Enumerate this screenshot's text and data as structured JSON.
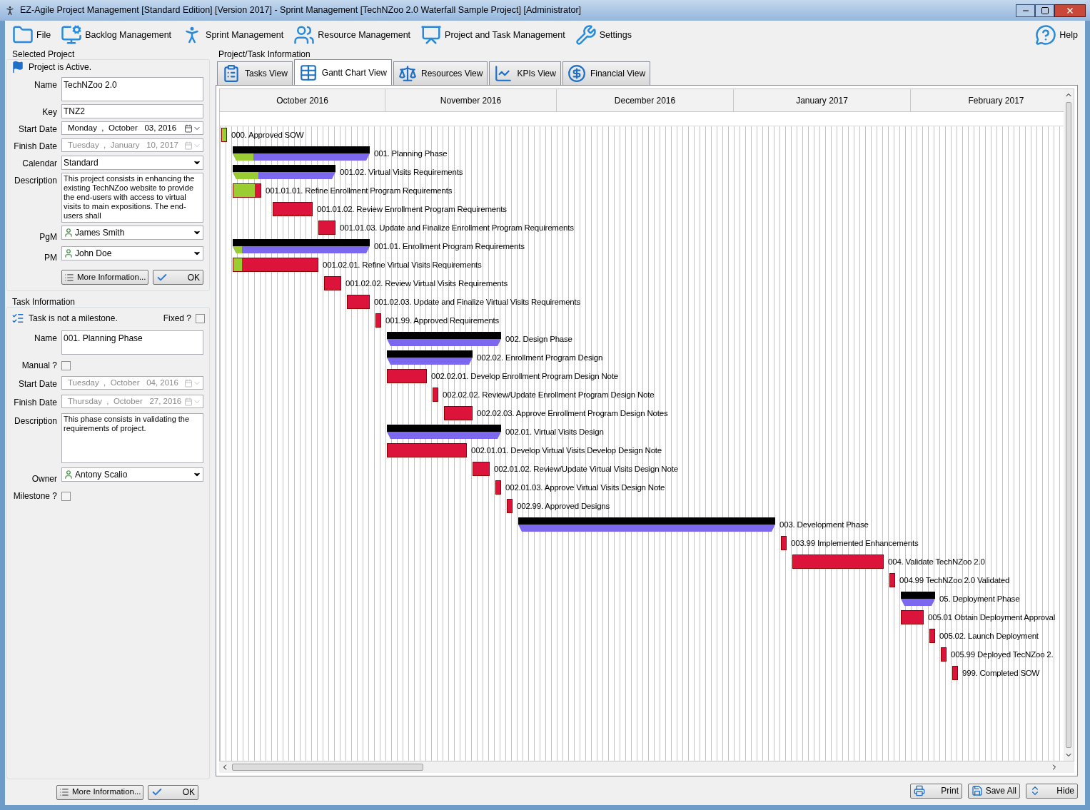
{
  "window": {
    "title": "EZ-Agile Project Management [Standard Edition] [Version 2017] - Sprint Management [TechNZoo 2.0 Waterfall Sample Project] [Administrator]"
  },
  "menu": [
    "File",
    "Backlog Management",
    "Sprint Management",
    "Resource Management",
    "Project and Task Management",
    "Settings"
  ],
  "help": "Help",
  "selected_project": {
    "heading": "Selected Project",
    "status": "Project is Active.",
    "fields": [
      {
        "label": "Name",
        "kind": "box",
        "value": "TechNZoo 2.0"
      },
      {
        "label": "Key",
        "kind": "text",
        "value": "TNZ2"
      },
      {
        "label": "Start Date",
        "kind": "date",
        "value": "Monday  ,  October   03, 2016",
        "disabled": false
      },
      {
        "label": "Finish Date",
        "kind": "date",
        "value": "Tuesday  ,  January   10, 2017",
        "disabled": true
      },
      {
        "label": "Calendar",
        "kind": "select",
        "value": "Standard"
      },
      {
        "label": "Description",
        "kind": "textarea",
        "value": "This project consists in enhancing the existing TechNZoo website to provide the end-users with access to virtual visits to main expositions. The end-users shall"
      },
      {
        "label": "PgM",
        "kind": "person",
        "value": "James Smith"
      },
      {
        "label": "PM",
        "kind": "person",
        "value": "John Doe"
      }
    ],
    "buttons": [
      "More Information...",
      "OK"
    ]
  },
  "task_information": {
    "heading": "Task Information",
    "status": "Task is not a milestone.",
    "fixed": {
      "label": "Fixed ?",
      "checked": false
    },
    "fields": [
      {
        "label": "Name",
        "kind": "box",
        "value": "001. Planning Phase"
      },
      {
        "label": "Manual ?",
        "kind": "checkbox",
        "checked": false
      },
      {
        "label": "Start Date",
        "kind": "date",
        "value": "Tuesday  ,  October   04, 2016",
        "disabled": true
      },
      {
        "label": "Finish Date",
        "kind": "date",
        "value": "Thursday  ,  October   27, 2016",
        "disabled": true
      },
      {
        "label": "Description",
        "kind": "textarea",
        "value": "This phase consists in validating the requirements of project."
      },
      {
        "label": "Owner",
        "kind": "person",
        "value": "Antony Scalio"
      },
      {
        "label": "Milestone ?",
        "kind": "checkbox",
        "checked": false
      }
    ],
    "buttons": [
      "More Information...",
      "OK"
    ]
  },
  "project_task_information": {
    "heading": "Project/Task Information",
    "tabs": [
      {
        "label": "Tasks View",
        "selected": false
      },
      {
        "label": "Gantt Chart View",
        "selected": true
      },
      {
        "label": "Resources View",
        "selected": false
      },
      {
        "label": "KPIs View",
        "selected": false
      },
      {
        "label": "Financial View",
        "selected": false
      }
    ]
  },
  "gantt": {
    "months": [
      "October 2016",
      "November 2016",
      "December 2016",
      "January 2017",
      "February 2017"
    ],
    "tasks": [
      {
        "label": "000. Approved SOW",
        "kind": "task",
        "level": 1
      },
      {
        "label": "001. Planning Phase",
        "kind": "summary",
        "level": 0.15
      },
      {
        "label": "001.02. Virtual Visits Requirements",
        "kind": "summary",
        "level": 0.25
      },
      {
        "label": "001.01.01. Refine Enrollment Program Requirements",
        "kind": "task",
        "level": 0.78
      },
      {
        "label": "001.01.02. Review Enrollment Program Requirements",
        "kind": "task"
      },
      {
        "label": "001.01.03. Update and Finalize Enrollment Program Requirements",
        "kind": "task"
      },
      {
        "label": "001.01. Enrollment Program Requirements",
        "kind": "summary",
        "level": 0.07
      },
      {
        "label": "001.02.01. Refine Virtual Visits Requirements",
        "kind": "task",
        "level": 0.1
      },
      {
        "label": "001.02.02. Review Virtual Visits Requirements",
        "kind": "task"
      },
      {
        "label": "001.02.03. Update and Finalize Virtual Visits Requirements",
        "kind": "task"
      },
      {
        "label": "001.99. Approved Requirements",
        "kind": "task"
      },
      {
        "label": "002. Design Phase",
        "kind": "summary"
      },
      {
        "label": "002.02. Enrollment Program Design",
        "kind": "summary"
      },
      {
        "label": "002.02.01. Develop Enrollment Program Design Note",
        "kind": "task"
      },
      {
        "label": "002.02.02. Review/Update Enrollment Program Design Note",
        "kind": "task"
      },
      {
        "label": "002.02.03. Approve Enrollment Program Design Notes",
        "kind": "task"
      },
      {
        "label": "002.01. Virtual Visits Design",
        "kind": "summary"
      },
      {
        "label": "002.01.01. Develop Virtual Visits Develop Design Note",
        "kind": "task"
      },
      {
        "label": "002.01.02. Review/Update Virtual Visits Design Note",
        "kind": "task"
      },
      {
        "label": "002.01.03. Approve Virtual Visits Design Note",
        "kind": "task"
      },
      {
        "label": "002.99. Approved Designs",
        "kind": "task"
      },
      {
        "label": "003. Development Phase",
        "kind": "summary"
      },
      {
        "label": "003.99 Implemented Enhancements",
        "kind": "task"
      },
      {
        "label": "004. Validate TechNZoo 2.0",
        "kind": "task"
      },
      {
        "label": "004.99 TechNZoo 2.0 Validated",
        "kind": "task"
      },
      {
        "label": "05. Deployment Phase",
        "kind": "summary"
      },
      {
        "label": "005.01 Obtain Deployment Approval",
        "kind": "task"
      },
      {
        "label": "005.02. Launch Deployment",
        "kind": "task"
      },
      {
        "label": "005.99 Deployed TecNZoo 2.",
        "kind": "task"
      },
      {
        "label": "999. Completed SOW",
        "kind": "task"
      }
    ]
  },
  "footer_buttons": [
    "Print",
    "Save All",
    "Hide"
  ]
}
